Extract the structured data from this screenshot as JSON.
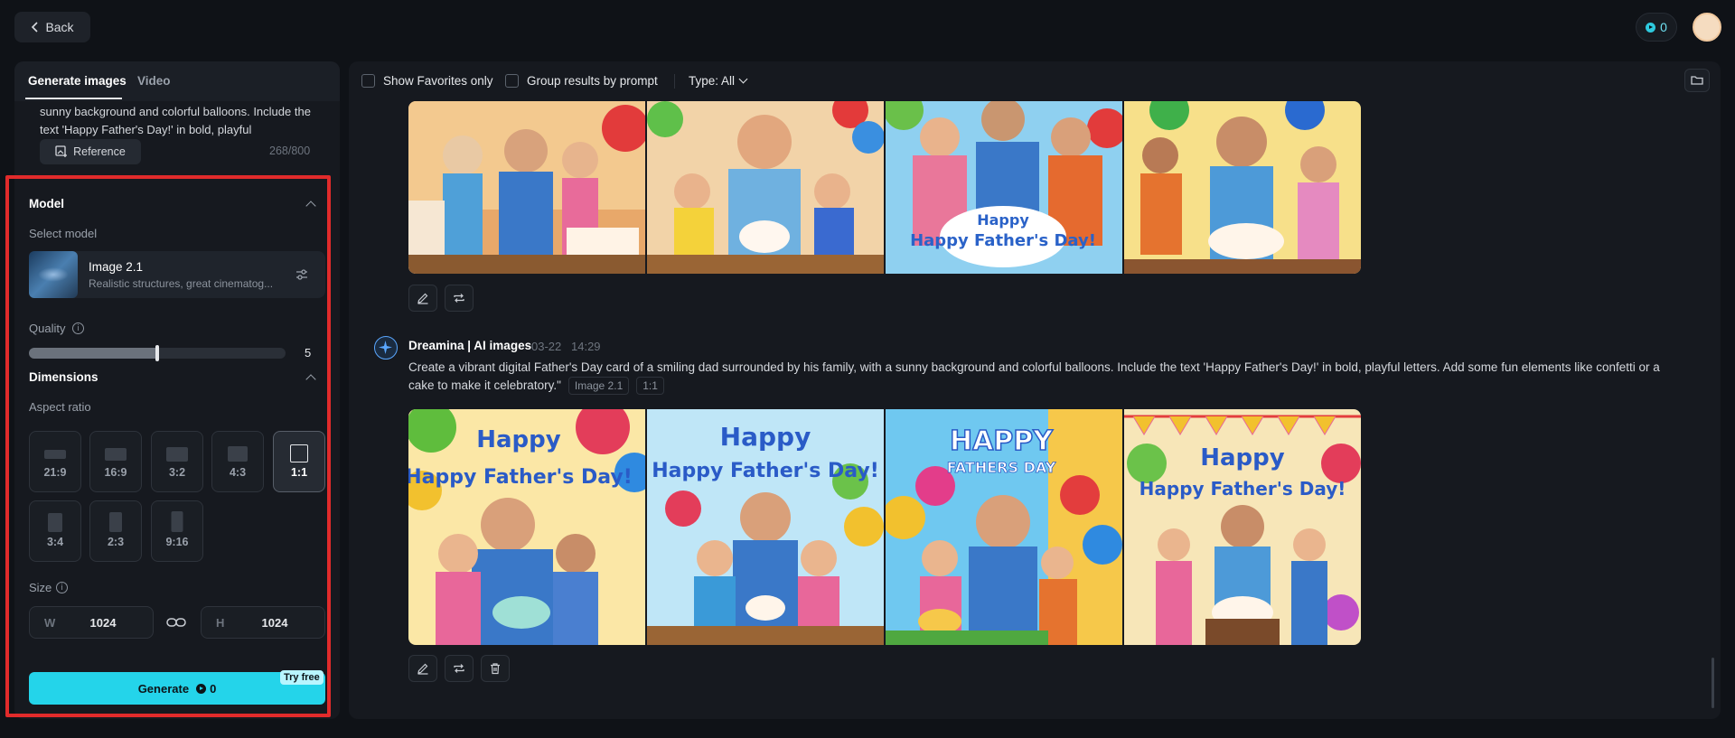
{
  "topbar": {
    "back_label": "Back",
    "credits": "0"
  },
  "left": {
    "tabs": [
      {
        "label": "Generate images",
        "active": true
      },
      {
        "label": "Video",
        "active": false
      }
    ],
    "prompt_visible": "sunny background and colorful balloons. Include the text 'Happy Father's Day!' in bold, playful",
    "reference_label": "Reference",
    "char_count": "268/800",
    "model_section": {
      "title": "Model",
      "select_label": "Select model",
      "model_name": "Image 2.1",
      "model_desc": "Realistic structures, great cinematog..."
    },
    "quality": {
      "label": "Quality",
      "value": "5",
      "level_fraction": 0.5
    },
    "dimensions": {
      "title": "Dimensions",
      "aspect_label": "Aspect ratio",
      "ratios": [
        "21:9",
        "16:9",
        "3:2",
        "4:3",
        "1:1",
        "3:4",
        "2:3",
        "9:16"
      ],
      "selected_ratio": "1:1",
      "size_label": "Size",
      "width_prefix": "W",
      "width_value": "1024",
      "height_prefix": "H",
      "height_value": "1024"
    },
    "generate": {
      "label": "Generate",
      "cost": "0",
      "badge": "Try free"
    }
  },
  "main": {
    "toolbar": {
      "favorites_label": "Show Favorites only",
      "group_label": "Group results by prompt",
      "type_label": "Type: All"
    },
    "entry": {
      "author": "Dreamina | AI images",
      "date": "03-22",
      "time": "14:29",
      "prompt": "Create a vibrant digital Father's Day card of a smiling dad surrounded by his family, with a sunny background and colorful balloons. Include the text 'Happy Father's Day!' in bold, playful letters. Add some fun elements like confetti or a cake to make it celebratory.\"",
      "model_tag": "Image 2.1",
      "ratio_tag": "1:1"
    },
    "image_text": {
      "top_3": "Happy Father's Day!",
      "bottom_1": "Happy Father's Day!",
      "bottom_2": "Happy Father's Day!",
      "bottom_3_line1": "HAPPY",
      "bottom_3_line2": "FATHERS DAY",
      "bottom_4": "Happy Father's Day!"
    },
    "colors": {
      "accent": "#24d4ea",
      "highlight": "#e12b2b"
    }
  }
}
